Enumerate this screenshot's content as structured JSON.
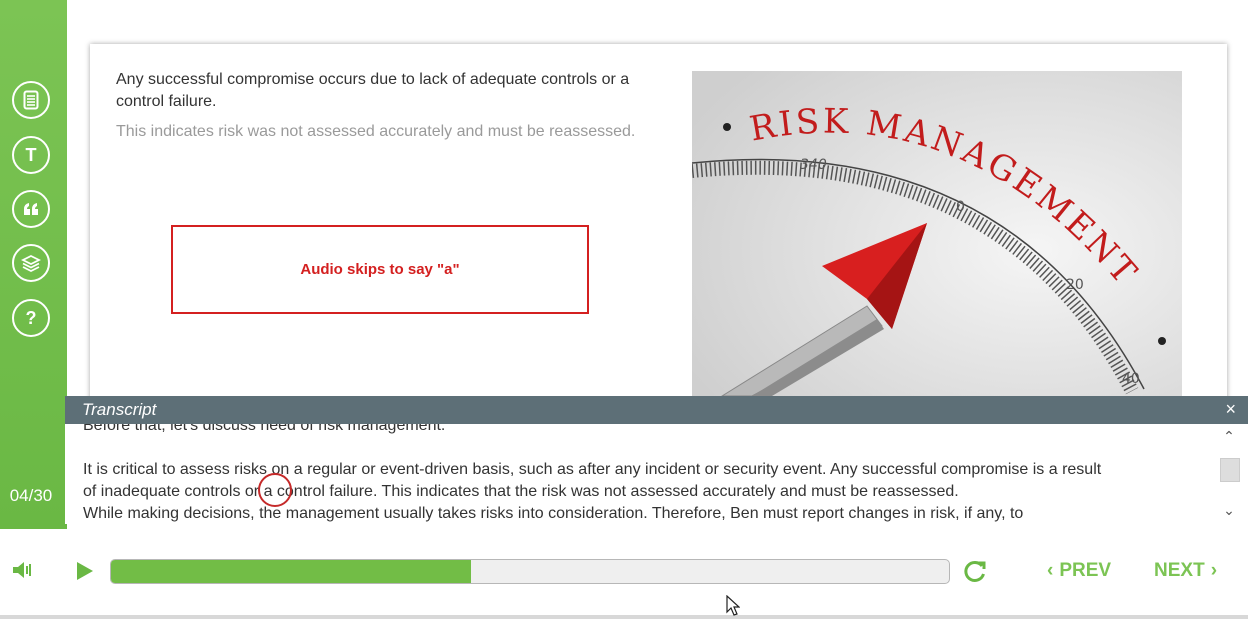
{
  "sidebar": {
    "buttons": [
      {
        "icon": "notes-icon"
      },
      {
        "icon": "text-icon",
        "label": "T"
      },
      {
        "icon": "quote-icon"
      },
      {
        "icon": "layers-icon"
      },
      {
        "icon": "help-icon",
        "label": "?"
      }
    ],
    "slide_counter": "04/30",
    "color": "#72bd46"
  },
  "slide": {
    "paragraph1": "Any successful compromise occurs due to lack of adequate controls or a control failure.",
    "paragraph2": "This indicates risk was not assessed accurately and must be reassessed.",
    "annotation": "Audio skips to say \"a\"",
    "image_text": {
      "title": "RISK MANAGEMENT",
      "ticks": [
        "340",
        "0",
        "20",
        "40"
      ]
    }
  },
  "transcript": {
    "title": "Transcript",
    "close": "×",
    "lines": [
      "Before that, let's discuss need of risk management.",
      "It is critical to assess risks on a regular or event-driven basis, such as after any incident or security event. Any successful compromise is a result",
      "of inadequate controls or a control failure. This indicates that the risk was not assessed accurately and must be reassessed.",
      "While making decisions, the management usually takes risks into consideration. Therefore, Ben must report changes in risk, if any, to"
    ]
  },
  "player": {
    "progress": 0.43,
    "prev_label": "PREV",
    "next_label": "NEXT",
    "accent": "#7cc454"
  }
}
